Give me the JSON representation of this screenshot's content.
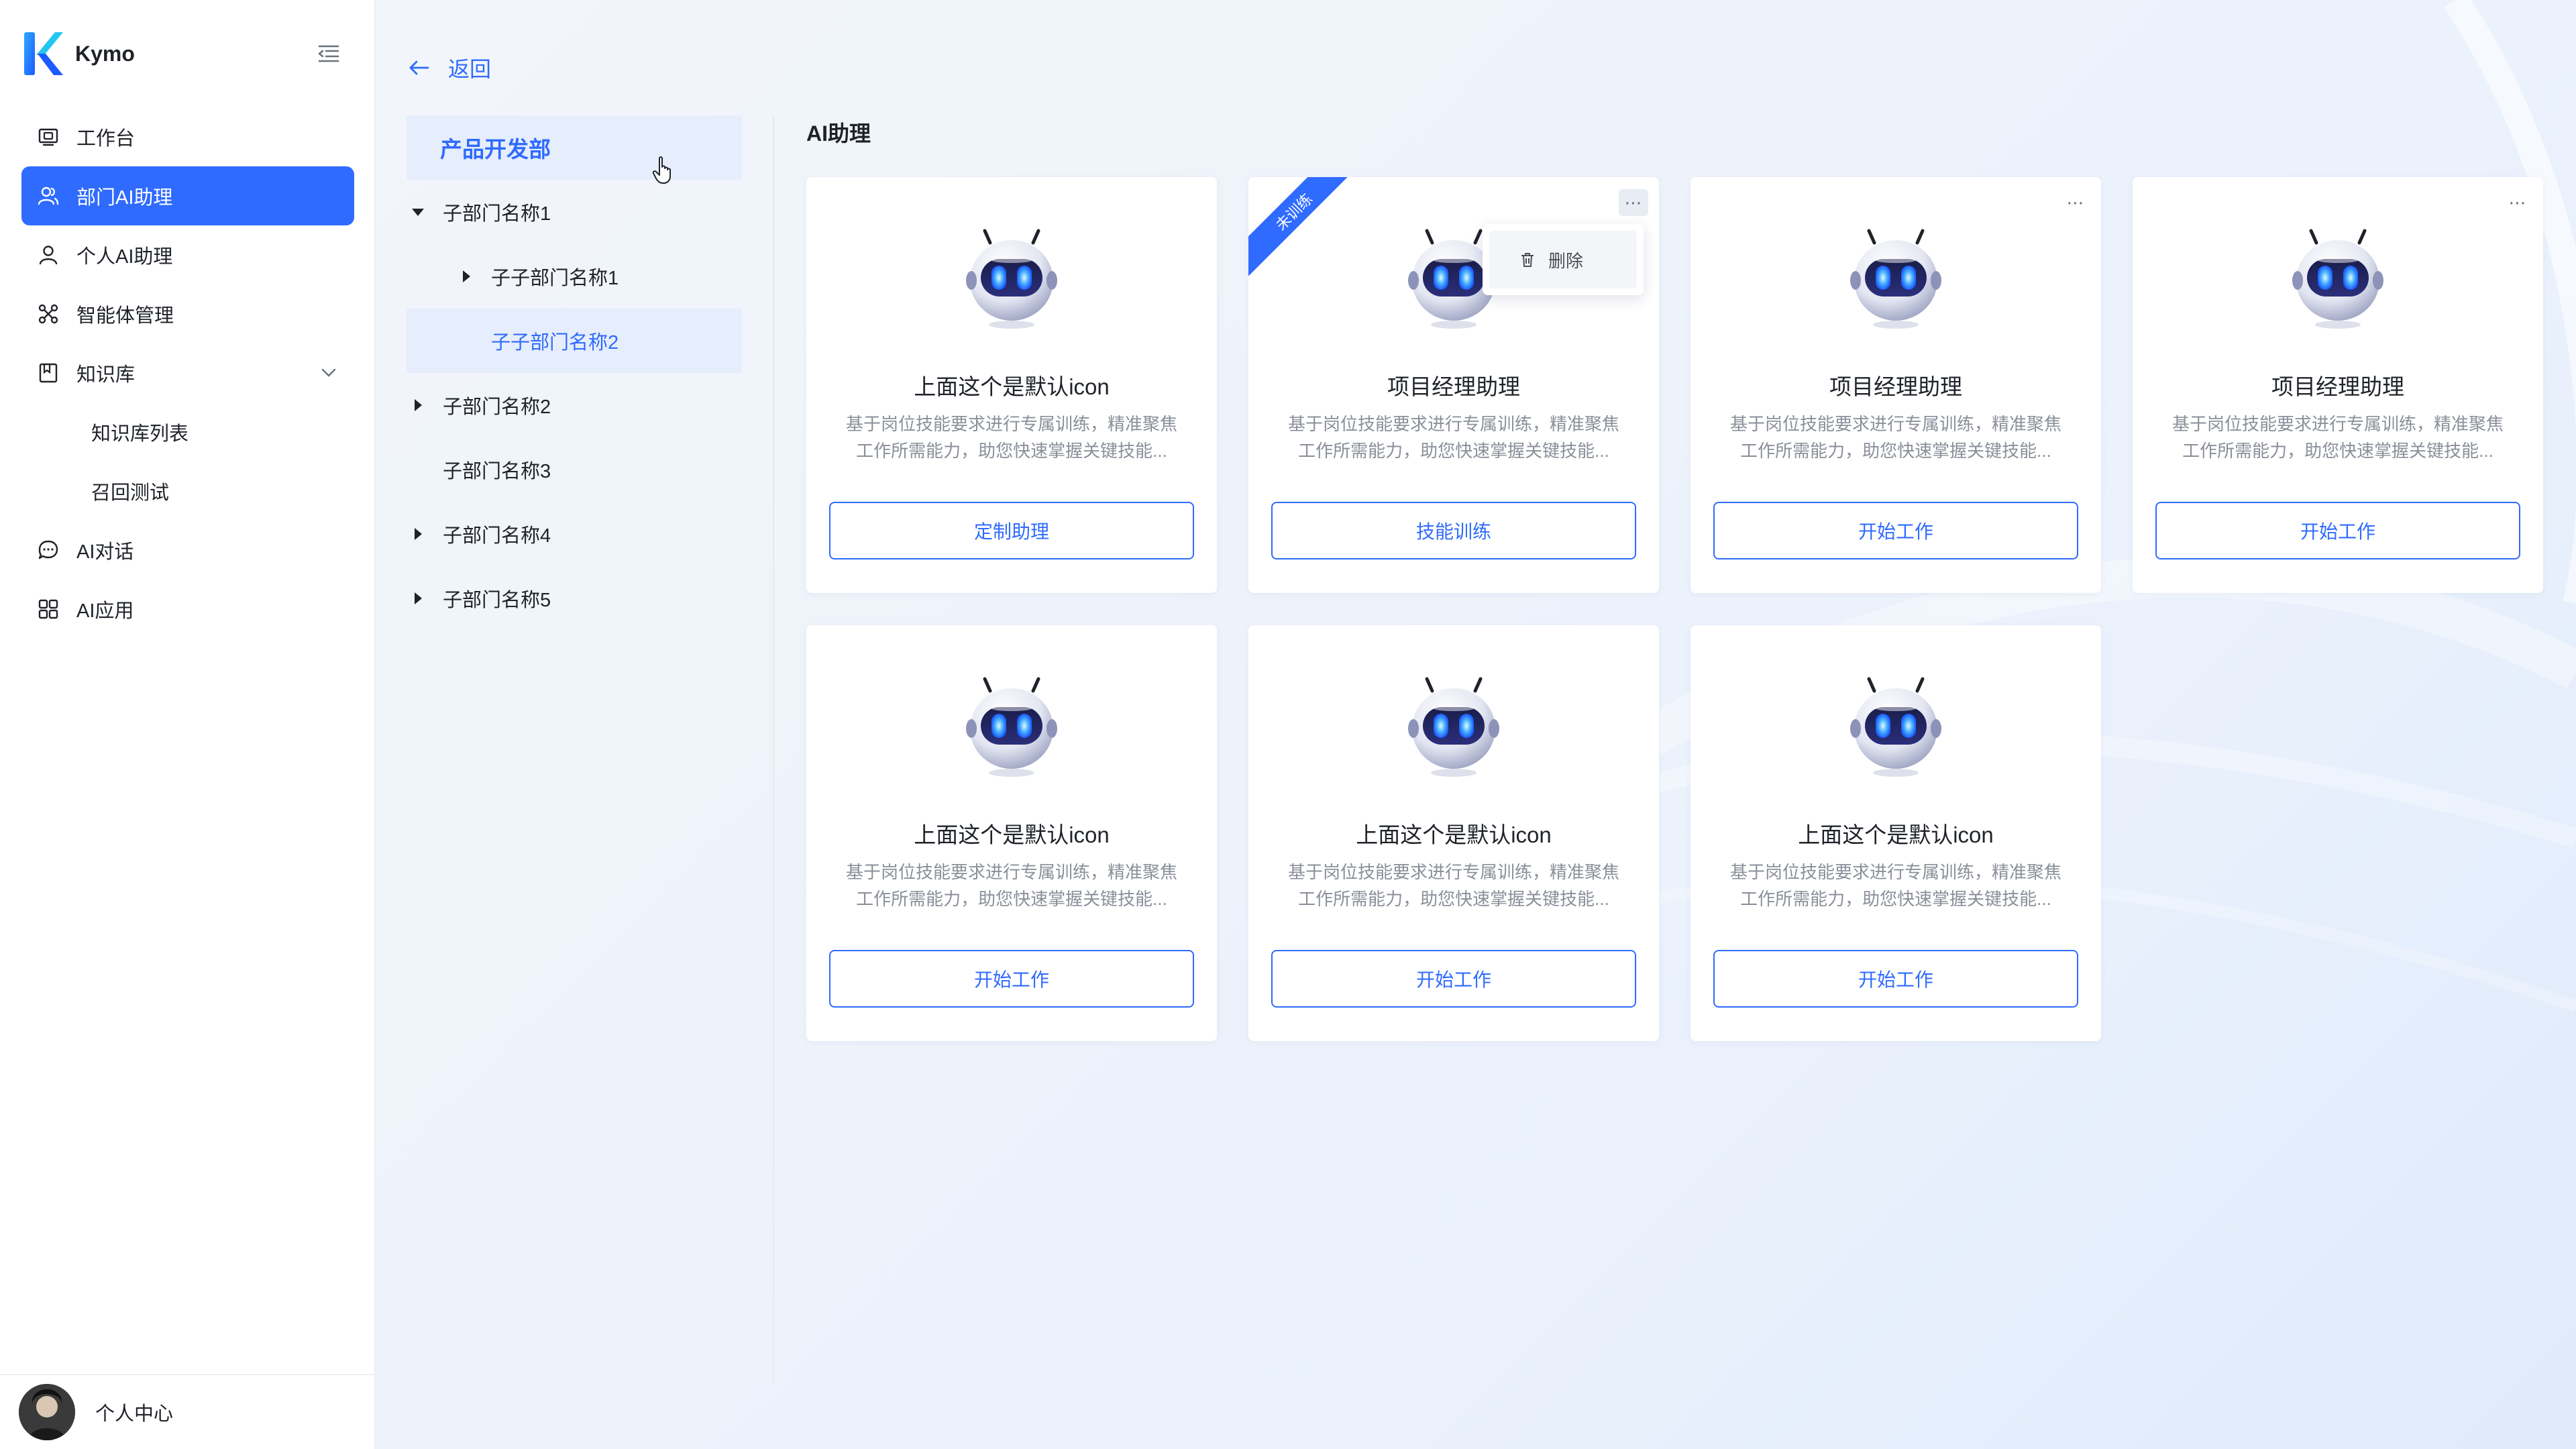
{
  "app": {
    "name": "Kymo"
  },
  "sidebar": {
    "items": [
      {
        "label": "工作台",
        "icon": "monitor-icon"
      },
      {
        "label": "部门AI助理",
        "icon": "users-icon",
        "active": true
      },
      {
        "label": "个人AI助理",
        "icon": "user-icon"
      },
      {
        "label": "智能体管理",
        "icon": "agent-icon"
      },
      {
        "label": "知识库",
        "icon": "book-icon",
        "expanded": true,
        "children": [
          "知识库列表",
          "召回测试"
        ]
      },
      {
        "label": "AI对话",
        "icon": "chat-icon"
      },
      {
        "label": "AI应用",
        "icon": "apps-icon"
      }
    ],
    "user_label": "个人中心"
  },
  "back_label": "返回",
  "dept": {
    "root": "产品开发部",
    "tree": [
      {
        "label": "子部门名称1",
        "level": 1,
        "caret": "down"
      },
      {
        "label": "子子部门名称1",
        "level": 2,
        "caret": "right"
      },
      {
        "label": "子子部门名称2",
        "level": 2,
        "caret": "none",
        "selected": true
      },
      {
        "label": "子部门名称2",
        "level": 1,
        "caret": "right"
      },
      {
        "label": "子部门名称3",
        "level": 1,
        "caret": "none"
      },
      {
        "label": "子部门名称4",
        "level": 1,
        "caret": "right"
      },
      {
        "label": "子部门名称5",
        "level": 1,
        "caret": "right"
      }
    ]
  },
  "main": {
    "title": "AI助理",
    "cards": [
      {
        "title": "上面这个是默认icon",
        "desc1": "基于岗位技能要求进行专属训练，精准聚焦",
        "desc2": "工作所需能力，助您快速掌握关键技能...",
        "button": "定制助理",
        "more": false
      },
      {
        "title": "项目经理助理",
        "desc1": "基于岗位技能要求进行专属训练，精准聚焦",
        "desc2": "工作所需能力，助您快速掌握关键技能...",
        "button": "技能训练",
        "more": true,
        "ribbon": "未训练"
      },
      {
        "title": "项目经理助理",
        "desc1": "基于岗位技能要求进行专属训练，精准聚焦",
        "desc2": "工作所需能力，助您快速掌握关键技能...",
        "button": "开始工作",
        "more": true
      },
      {
        "title": "项目经理助理",
        "desc1": "基于岗位技能要求进行专属训练，精准聚焦",
        "desc2": "工作所需能力，助您快速掌握关键技能...",
        "button": "开始工作",
        "more": true
      },
      {
        "title": "上面这个是默认icon",
        "desc1": "基于岗位技能要求进行专属训练，精准聚焦",
        "desc2": "工作所需能力，助您快速掌握关键技能...",
        "button": "开始工作",
        "more": false
      },
      {
        "title": "上面这个是默认icon",
        "desc1": "基于岗位技能要求进行专属训练，精准聚焦",
        "desc2": "工作所需能力，助您快速掌握关键技能...",
        "button": "开始工作",
        "more": false
      },
      {
        "title": "上面这个是默认icon",
        "desc1": "基于岗位技能要求进行专属训练，精准聚焦",
        "desc2": "工作所需能力，助您快速掌握关键技能...",
        "button": "开始工作",
        "more": false
      }
    ],
    "dropdown": {
      "delete_label": "删除"
    }
  },
  "colors": {
    "accent": "#2f6bff",
    "selected_bg": "#e6edfc"
  }
}
